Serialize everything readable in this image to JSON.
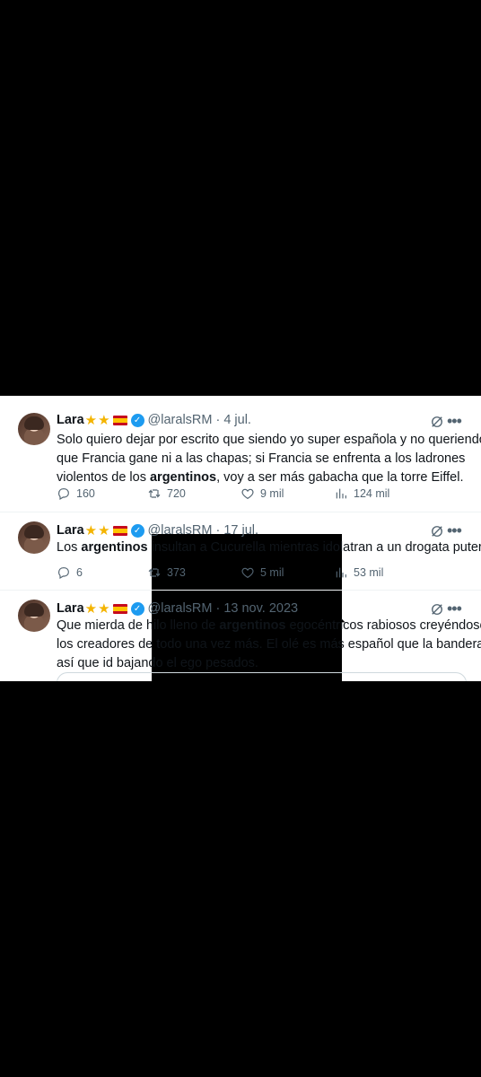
{
  "tweets": [
    {
      "name": "Lara",
      "handle": "@laralsRM",
      "date": "4 jul.",
      "lines": [
        [
          "Solo quiero dejar por escrito que siendo yo super española y no queriendo"
        ],
        [
          "que Francia gane ni a las chapas; si Francia se enfrenta a los ladrones"
        ],
        [
          "violentos de los ",
          "argentinos",
          ", voy a ser más gabacha que la torre Eiffel."
        ]
      ],
      "metrics": {
        "replies": "160",
        "reposts": "720",
        "likes": "9 mil",
        "views": "124 mil"
      }
    },
    {
      "name": "Lara",
      "handle": "@laralsRM",
      "date": "17 jul.",
      "lines": [
        [
          "Los ",
          "argentinos",
          " insultan a Cucurella mientras idolatran a un drogata putero."
        ]
      ],
      "metrics": {
        "replies": "6",
        "reposts": "373",
        "likes": "5 mil",
        "views": "53 mil"
      }
    },
    {
      "name": "Lara",
      "handle": "@laralsRM",
      "date": "13 nov. 2023",
      "lines": [
        [
          "Que mierda de hilo lleno de ",
          "argentinos",
          " egocéntricos rabiosos creyéndose"
        ],
        [
          "los creadores de todo una vez más. El olé es más español que la bandera"
        ],
        [
          "así que id bajando el ego pesados."
        ]
      ]
    }
  ],
  "icons": {
    "name_badges": [
      "star-icon",
      "star-icon",
      "spain-flag-icon",
      "verified-badge-icon"
    ],
    "header_actions": [
      "grok-icon",
      "more-icon"
    ],
    "actions": [
      "reply-icon",
      "repost-icon",
      "like-icon",
      "views-icon",
      "bookmark-icon",
      "share-icon"
    ]
  },
  "colors": {
    "background": "#000000",
    "panel": "#ffffff",
    "verified": "#1d9bf0",
    "secondary_text": "#536471"
  }
}
